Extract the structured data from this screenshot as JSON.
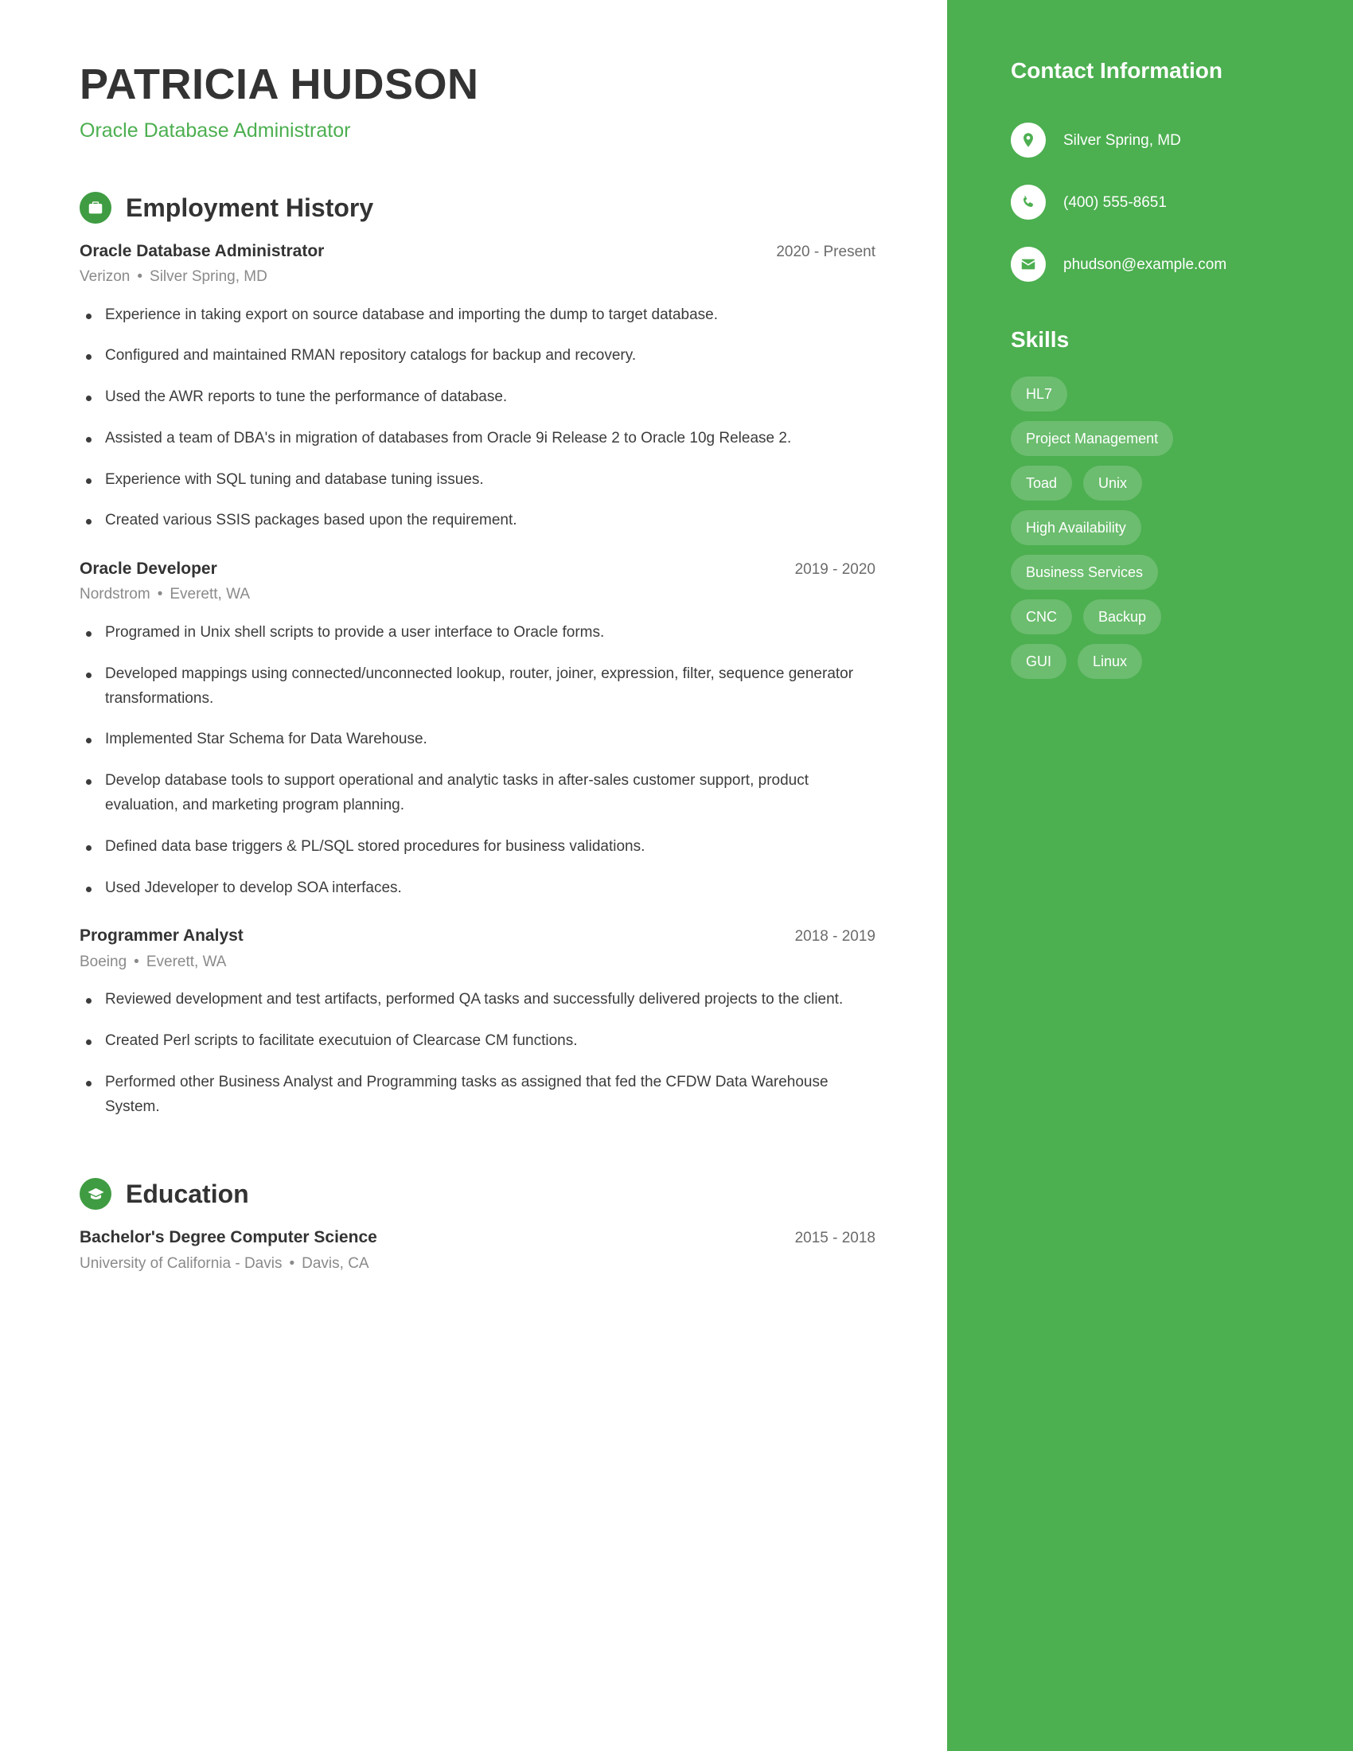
{
  "header": {
    "name": "PATRICIA HUDSON",
    "title": "Oracle Database Administrator"
  },
  "colors": {
    "accent_green": "#4caf50",
    "icon_circle_green": "#3f9c42",
    "heading_dark": "#333333",
    "body_text": "#3c3c3c",
    "muted_text": "#8a8a8a",
    "sidebar_bg": "#4caf50",
    "pill_bg": "rgba(255,255,255,0.18)"
  },
  "sections": {
    "employment": {
      "heading": "Employment History",
      "icon": "briefcase-icon",
      "entries": [
        {
          "title": "Oracle Database Administrator",
          "date": "2020 - Present",
          "company": "Verizon",
          "location": "Silver Spring, MD",
          "bullets": [
            "Experience in taking export on source database and importing the dump to target database.",
            "Configured and maintained RMAN repository catalogs for backup and recovery.",
            "Used the AWR reports to tune the performance of database.",
            "Assisted a team of DBA's in migration of databases from Oracle 9i Release 2 to Oracle 10g Release 2.",
            "Experience with SQL tuning and database tuning issues.",
            "Created various SSIS packages based upon the requirement."
          ]
        },
        {
          "title": "Oracle Developer",
          "date": "2019 - 2020",
          "company": "Nordstrom",
          "location": "Everett, WA",
          "bullets": [
            "Programed in Unix shell scripts to provide a user interface to Oracle forms.",
            "Developed mappings using connected/unconnected lookup, router, joiner, expression, filter, sequence generator transformations.",
            "Implemented Star Schema for Data Warehouse.",
            "Develop database tools to support operational and analytic tasks in after-sales customer support, product evaluation, and marketing program planning.",
            "Defined data base triggers & PL/SQL stored procedures for business validations.",
            "Used Jdeveloper to develop SOA interfaces."
          ]
        },
        {
          "title": "Programmer Analyst",
          "date": "2018 - 2019",
          "company": "Boeing",
          "location": "Everett, WA",
          "bullets": [
            "Reviewed development and test artifacts, performed QA tasks and successfully delivered projects to the client.",
            "Created Perl scripts to facilitate executuion of Clearcase CM functions.",
            "Performed other Business Analyst and Programming tasks as assigned that fed the CFDW Data Warehouse System."
          ]
        }
      ]
    },
    "education": {
      "heading": "Education",
      "icon": "graduation-cap-icon",
      "entries": [
        {
          "title": "Bachelor's Degree Computer Science",
          "date": "2015 - 2018",
          "school": "University of California - Davis",
          "location": "Davis, CA"
        }
      ]
    }
  },
  "sidebar": {
    "contact": {
      "heading": "Contact Information",
      "items": [
        {
          "icon": "location-pin-icon",
          "value": "Silver Spring, MD"
        },
        {
          "icon": "phone-icon",
          "value": "(400) 555-8651"
        },
        {
          "icon": "envelope-icon",
          "value": "phudson@example.com"
        }
      ]
    },
    "skills": {
      "heading": "Skills",
      "items": [
        "HL7",
        "Project Management",
        "Toad",
        "Unix",
        "High Availability",
        "Business Services",
        "CNC",
        "Backup",
        "GUI",
        "Linux"
      ]
    }
  },
  "separator": "•"
}
